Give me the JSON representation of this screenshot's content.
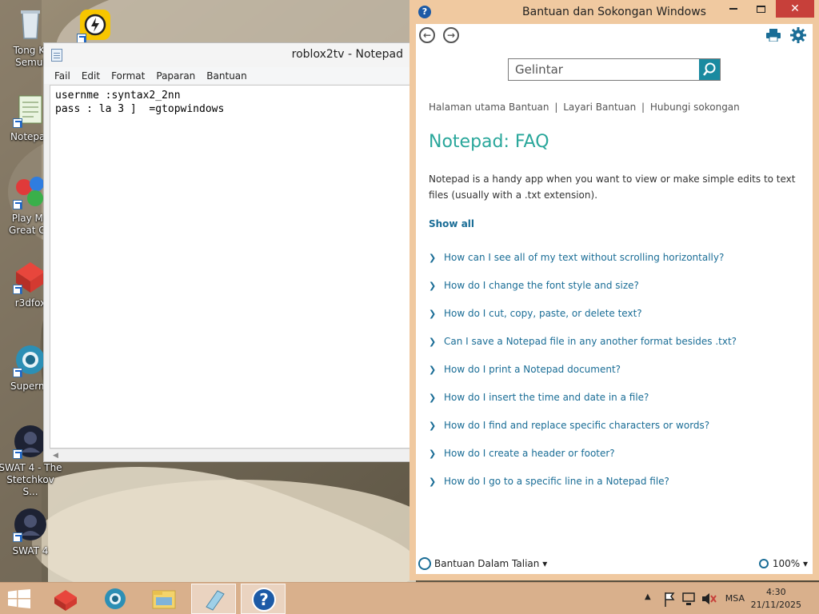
{
  "desktop": {
    "icons": [
      {
        "label": "Tong Ki",
        "label2": "Semul",
        "name": "recycle-bin"
      },
      {
        "label": "Notepac",
        "label2": "",
        "name": "notepad-shortcut"
      },
      {
        "label": "Play Mo",
        "label2": "Great Ga",
        "name": "play-games"
      },
      {
        "label": "r3dfox",
        "label2": "",
        "name": "r3dfox"
      },
      {
        "label": "Supermi",
        "label2": "",
        "name": "supermium"
      },
      {
        "label": "SWAT 4 - The",
        "label2": "Stetchkov S...",
        "name": "swat4-stetchkov"
      },
      {
        "label": "SWAT 4",
        "label2": "",
        "name": "swat4"
      }
    ]
  },
  "notepad": {
    "title": "roblox2tv - Notepad",
    "menu": [
      "Fail",
      "Edit",
      "Format",
      "Paparan",
      "Bantuan"
    ],
    "content": "usernme :syntax2_2nn\npass : la 3 ]  =gtopwindows"
  },
  "help": {
    "title": "Bantuan dan Sokongan Windows",
    "search_placeholder": "Gelintar",
    "breadcrumbs": [
      "Halaman utama Bantuan",
      "Layari Bantuan",
      "Hubungi sokongan"
    ],
    "page_title": "Notepad: FAQ",
    "intro": "Notepad is a handy app when you want to view or make simple edits to text files (usually with a .txt extension).",
    "show_all": "Show all",
    "faq": [
      "How can I see all of my text without scrolling horizontally?",
      "How do I change the font style and size?",
      "How do I cut, copy, paste, or delete text?",
      "Can I save a Notepad file in any another format besides .txt?",
      "How do I print a Notepad document?",
      "How do I insert the time and date in a file?",
      "How do I find and replace specific characters or words?",
      "How do I create a header or footer?",
      "How do I go to a specific line in a Notepad file?"
    ],
    "footer_online": "Bantuan Dalam Talian",
    "zoom": "100%"
  },
  "taskbar": {
    "language": "MSA",
    "time": "4:30",
    "date": "21/11/2025"
  },
  "colors": {
    "accent_teal": "#2aa79b",
    "link_blue": "#1a6d96",
    "help_frame": "#f0c9a0",
    "taskbar": "#d9b08c",
    "close_red": "#c7403a"
  }
}
